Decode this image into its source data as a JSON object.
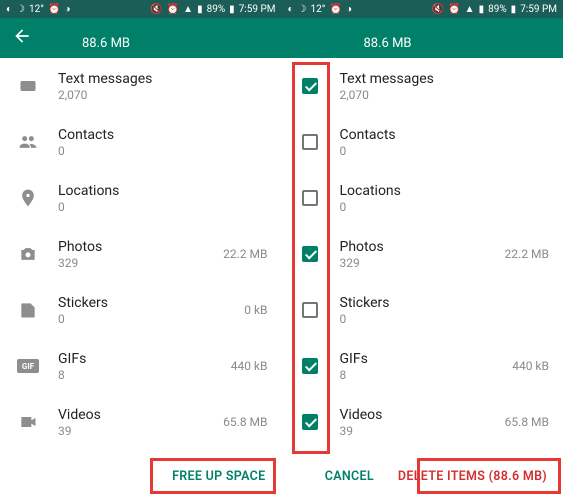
{
  "status": {
    "temp": "12°",
    "battery": "89%",
    "time": "7:59 PM"
  },
  "header": {
    "size": "88.6 MB"
  },
  "items": {
    "text_messages": {
      "title": "Text messages",
      "count": "2,070",
      "size": ""
    },
    "contacts": {
      "title": "Contacts",
      "count": "0",
      "size": ""
    },
    "locations": {
      "title": "Locations",
      "count": "0",
      "size": ""
    },
    "photos": {
      "title": "Photos",
      "count": "329",
      "size": "22.2 MB"
    },
    "stickers": {
      "title": "Stickers",
      "count": "0",
      "size": "0 kB"
    },
    "gifs": {
      "title": "GIFs",
      "count": "8",
      "size": "440 kB"
    },
    "videos": {
      "title": "Videos",
      "count": "39",
      "size": "65.8 MB"
    }
  },
  "right_items": {
    "contacts_count": "0",
    "locations_count": "0",
    "stickers_count": "0"
  },
  "footer": {
    "free_up": "FREE UP SPACE",
    "cancel": "CANCEL",
    "delete": "DELETE ITEMS (88.6 MB)"
  }
}
